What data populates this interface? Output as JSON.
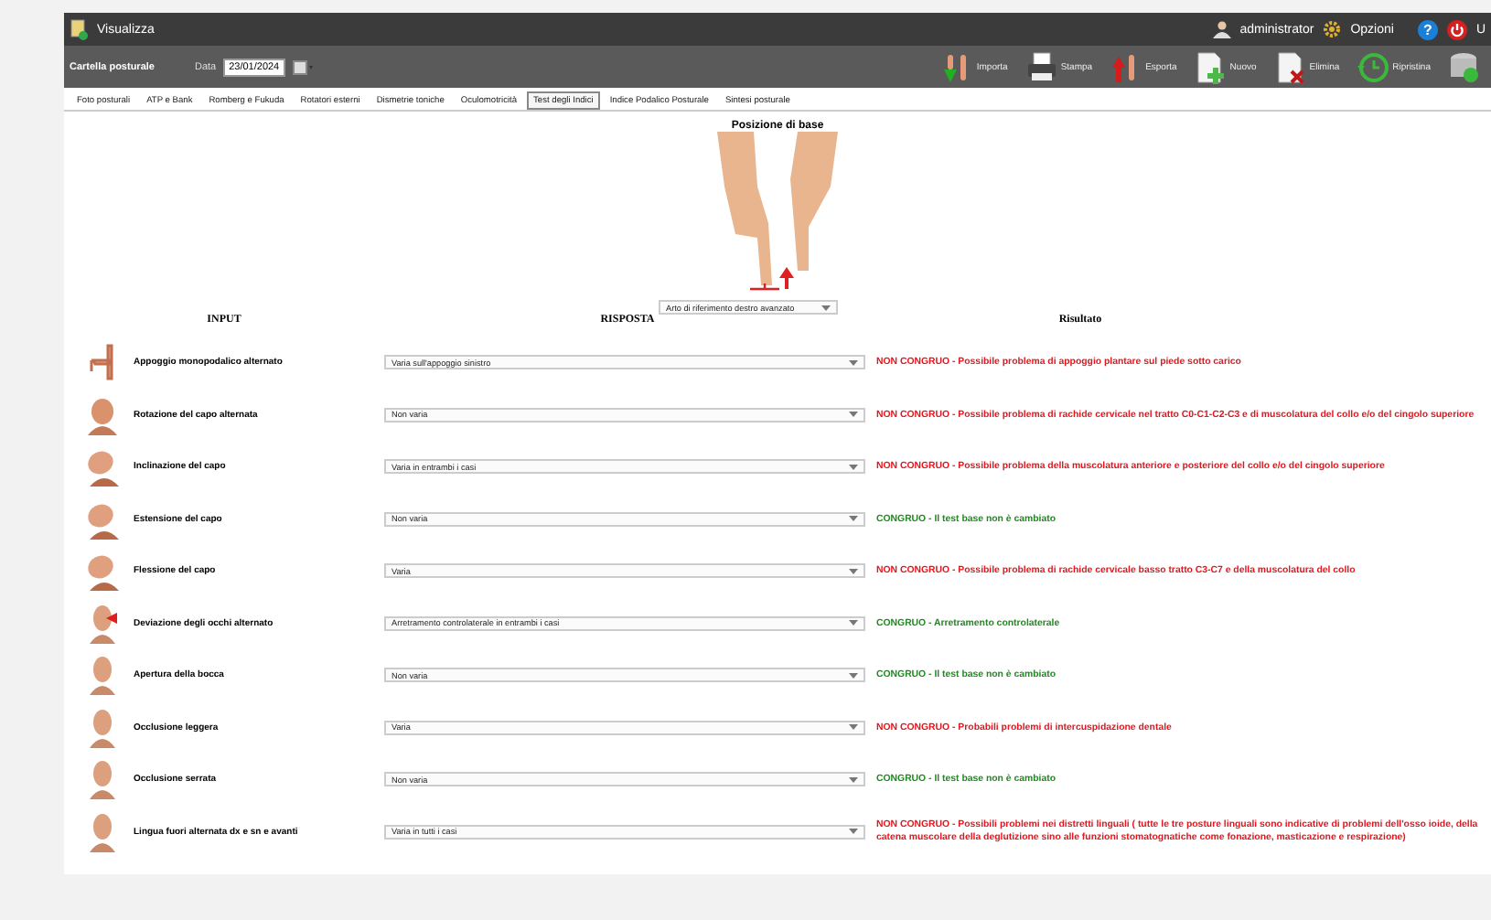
{
  "window": {
    "title": "Visualizza"
  },
  "user_menu": {
    "user": "administrator",
    "options": "Opzioni",
    "help": "?",
    "logout": "U"
  },
  "toolbar": {
    "section": "Cartella posturale",
    "date_label": "Data",
    "date_value": "23/01/2024",
    "buttons": [
      {
        "kind": "import",
        "label": "Importa"
      },
      {
        "kind": "print",
        "label": "Stampa"
      },
      {
        "kind": "export",
        "label": "Esporta"
      },
      {
        "kind": "new",
        "label": "Nuovo"
      },
      {
        "kind": "delete",
        "label": "Elimina"
      },
      {
        "kind": "restore",
        "label": "Ripristina"
      },
      {
        "kind": "database"
      }
    ]
  },
  "tabs": [
    {
      "label": "Foto posturali",
      "selected": false
    },
    {
      "label": "ATP e Bank",
      "selected": false
    },
    {
      "label": "Romberg e Fukuda",
      "selected": false
    },
    {
      "label": "Rotatori esterni",
      "selected": false
    },
    {
      "label": "Dismetrie toniche",
      "selected": false
    },
    {
      "label": "Oculomotricità",
      "selected": false
    },
    {
      "label": "Test degli Indici",
      "selected": true
    },
    {
      "label": "Indice Podalico Posturale",
      "selected": false
    },
    {
      "label": "Sintesi posturale",
      "selected": false
    }
  ],
  "base_position": {
    "title": "Posizione di base",
    "select_value": "Arto di riferimento destro avanzato"
  },
  "columns": {
    "input": "INPUT",
    "response": "RISPOSTA",
    "result": "Risultato"
  },
  "rows": [
    {
      "kind": "leg",
      "label": "Appoggio monopodalico alternato",
      "response": "Varia sull'appoggio sinistro",
      "ok": false,
      "verdict": "NON CONGRUO",
      "result": "- Possibile problema di appoggio plantare sul piede sotto carico"
    },
    {
      "kind": "head-turn",
      "label": "Rotazione del capo alternata",
      "response": "Non varia",
      "ok": false,
      "verdict": "NON CONGRUO",
      "result": "- Possibile problema di rachide cervicale nel tratto C0-C1-C2-C3 e di muscolatura del collo e/o del cingolo superiore"
    },
    {
      "kind": "head-side",
      "label": "Inclinazione del capo",
      "response": "Varia in entrambi i casi",
      "ok": false,
      "verdict": "NON CONGRUO",
      "result": "- Possibile problema della muscolatura anteriore e posteriore del collo e/o del cingolo superiore"
    },
    {
      "kind": "head-side",
      "label": "Estensione del capo",
      "response": "Non varia",
      "ok": true,
      "verdict": "CONGRUO",
      "result": "- Il test base non è cambiato"
    },
    {
      "kind": "head-side",
      "label": "Flessione del capo",
      "response": "Varia",
      "ok": false,
      "verdict": "NON CONGRUO",
      "result": "- Possibile problema di rachide cervicale basso tratto C3-C7 e della muscolatura del collo"
    },
    {
      "kind": "head-eyes",
      "label": "Deviazione degli occhi alternato",
      "response": "Arretramento controlaterale in entrambi i casi",
      "ok": true,
      "verdict": "CONGRUO",
      "result": "- Arretramento controlaterale"
    },
    {
      "kind": "head-front",
      "label": "Apertura della bocca",
      "response": "Non varia",
      "ok": true,
      "verdict": "CONGRUO",
      "result": "- Il test base non è cambiato"
    },
    {
      "kind": "head-front",
      "label": "Occlusione leggera",
      "response": "Varia",
      "ok": false,
      "verdict": "NON CONGRUO",
      "result": "- Probabili problemi di intercuspidazione dentale"
    },
    {
      "kind": "head-front",
      "label": "Occlusione serrata",
      "response": "Non varia",
      "ok": true,
      "verdict": "CONGRUO",
      "result": "- Il test base non è cambiato"
    },
    {
      "kind": "head-front",
      "label": "Lingua fuori alternata dx e sn e avanti",
      "response": "Varia in tutti i casi",
      "ok": false,
      "verdict": "NON CONGRUO",
      "result": "- Possibili problemi nei distretti linguali ( tutte le  tre posture linguali sono indicative di problemi dell'osso ioide, della catena muscolare della deglutizione sino alle funzioni stomatognatiche come fonazione, masticazione e respirazione)"
    }
  ]
}
